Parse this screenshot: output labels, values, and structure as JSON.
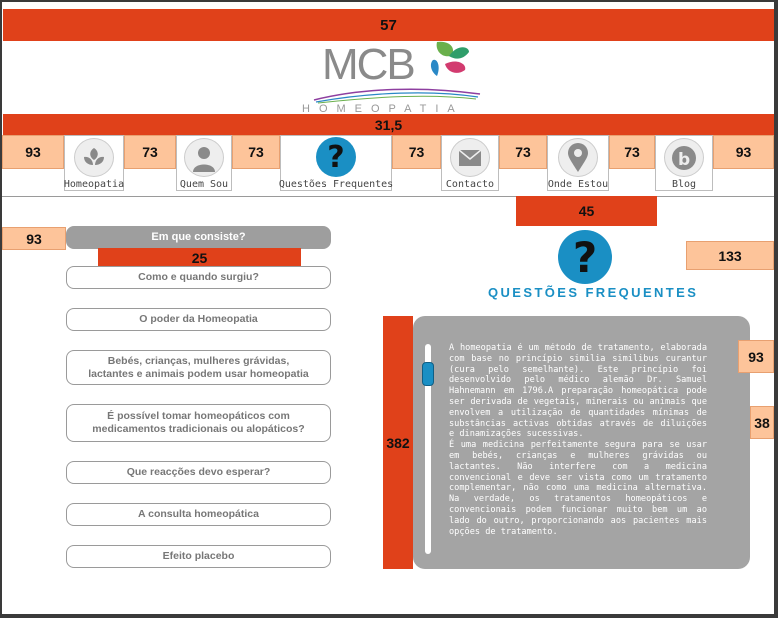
{
  "top_bar": {
    "value": "57"
  },
  "logo": {
    "mark": "MCB",
    "subtitle": "HOMEOPATIA"
  },
  "nav_bar_top": {
    "value": "31,5"
  },
  "nav": {
    "spacers": [
      "93",
      "73",
      "73",
      "73",
      "73",
      "73",
      "93"
    ],
    "items": [
      {
        "label": "Homeopatia",
        "icon": "leaves-icon"
      },
      {
        "label": "Quem Sou",
        "icon": "user-icon"
      },
      {
        "label": "Questões Frequentes",
        "icon": "question-icon"
      },
      {
        "label": "Contacto",
        "icon": "mail-icon"
      },
      {
        "label": "Onde Estou",
        "icon": "map-pin-icon"
      },
      {
        "label": "Blog",
        "icon": "blog-icon"
      }
    ]
  },
  "spacers_main": {
    "under_nav": "45",
    "left_margin": "93",
    "faq_gap": "25",
    "right_top": "133",
    "content_height": "382",
    "content_right": "93",
    "content_right_small": "38"
  },
  "section": {
    "title": "QUESTÕES FREQUENTES"
  },
  "faq": [
    "Em que consiste?",
    "Como e quando surgiu?",
    "O poder da Homeopatia",
    "Bebés, crianças, mulheres grávidas, lactantes e animais podem usar homeopatia",
    "É possível tomar homeopáticos com medicamentos tradicionais ou alopáticos?",
    "Que reacções devo esperar?",
    "A consulta homeopática",
    "Efeito placebo"
  ],
  "content": {
    "text": "A homeopatia é um método de tratamento, elaborada com base no princípio similia similibus curantur (cura pelo semelhante). Este princípio foi desenvolvido pelo médico alemão Dr. Samuel Hahnemann em 1796.A preparação homeopática pode ser derivada de vegetais, minerais ou animais que envolvem a utilização de quantidades mínimas de substâncias activas obtidas através de diluições e dinamizações sucessivas.\nÉ uma medicina perfeitamente segura para se usar em bebés, crianças e mulheres grávidas ou lactantes. Não interfere com a medicina convencional e deve ser vista como um tratamento complementar, não como uma medicina alternativa. Na verdade, os tratamentos homeopáticos e convencionais podem funcionar muito bem um ao lado do outro, proporcionando aos pacientes mais opções de tratamento."
  },
  "colors": {
    "accent_red": "#e0411a",
    "peach": "#fdc49a",
    "blue": "#1a8fc4",
    "box_grey": "#a4a4a4"
  }
}
